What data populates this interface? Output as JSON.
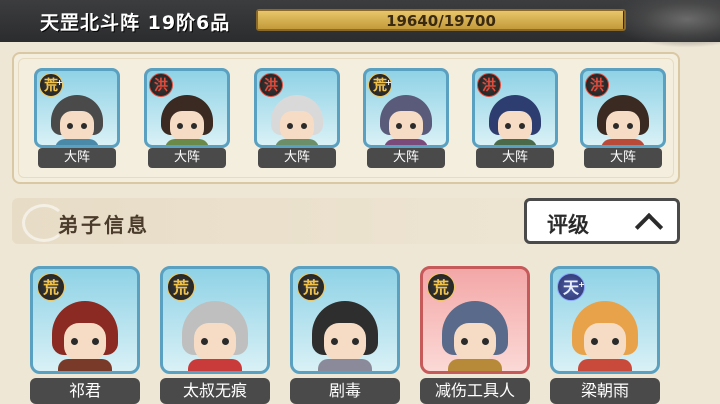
{
  "header": {
    "formation_title": "天罡北斗阵 19阶6品",
    "progress_text": "19640/19700",
    "progress_fraction": 0.997
  },
  "formation_slots": [
    {
      "badge": "荒",
      "badge_plus": "+",
      "label": "大阵",
      "hair": "#4a4a4a",
      "body": "#4b89a8"
    },
    {
      "badge": "洪",
      "badge_plus": "",
      "label": "大阵",
      "hair": "#3a2a22",
      "body": "#6b8a4a"
    },
    {
      "badge": "洪",
      "badge_plus": "",
      "label": "大阵",
      "hair": "#d9d9d9",
      "body": "#6c8f6a"
    },
    {
      "badge": "荒",
      "badge_plus": "+",
      "label": "大阵",
      "hair": "#5a5b7a",
      "body": "#7a4a7a"
    },
    {
      "badge": "洪",
      "badge_plus": "",
      "label": "大阵",
      "hair": "#2d3d70",
      "body": "#4b6a4a"
    },
    {
      "badge": "洪",
      "badge_plus": "",
      "label": "大阵",
      "hair": "#3a2a22",
      "body": "#b94a3a"
    }
  ],
  "section": {
    "title": "弟子信息",
    "sort_label": "评级"
  },
  "disciples": [
    {
      "badge": "荒",
      "badge_plus": "",
      "name": "祁君",
      "hair": "#8a2a22",
      "body": "#7a3a2a",
      "card": "blue"
    },
    {
      "badge": "荒",
      "badge_plus": "",
      "name": "太叔无痕",
      "hair": "#bfbfbf",
      "body": "#c93a3a",
      "card": "blue"
    },
    {
      "badge": "荒",
      "badge_plus": "",
      "name": "剧毒",
      "hair": "#2e2e2e",
      "body": "#8a8a9a",
      "card": "blue"
    },
    {
      "badge": "荒",
      "badge_plus": "",
      "name": "减伤工具人",
      "hair": "#5a6a8a",
      "body": "#b78a3a",
      "card": "pink"
    },
    {
      "badge": "天",
      "badge_plus": "+",
      "name": "梁朝雨",
      "hair": "#e8a24a",
      "body": "#c94a3a",
      "card": "blue"
    }
  ]
}
